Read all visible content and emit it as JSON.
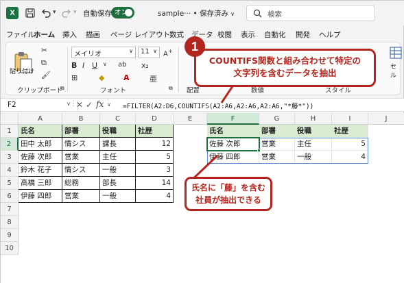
{
  "titlebar": {
    "app_icon": "X",
    "autosave_label": "自動保存",
    "autosave_state": "オン",
    "file_title": "sample··· • 保存済み",
    "search_placeholder": "検索"
  },
  "ribbon_tabs": [
    "ファイル",
    "ホーム",
    "挿入",
    "描画",
    "ページ レイアウト",
    "数式",
    "データ",
    "校閲",
    "表示",
    "自動化",
    "開発",
    "ヘルプ"
  ],
  "ribbon": {
    "paste_label": "貼り付け",
    "clipboard_label": "クリップボード",
    "font_name": "メイリオ",
    "font_size": "11",
    "font_label": "フォント",
    "align_label": "配置",
    "number_label": "数値",
    "style_label": "スタイル",
    "cell_label": "セル"
  },
  "formula_bar": {
    "name_box": "F2",
    "fx": "fx",
    "formula": "=FILTER(A2:D6,COUNTIFS(A2:A6,A2:A6,A2:A6,\"*藤*\"))"
  },
  "columns": [
    "A",
    "B",
    "C",
    "D",
    "E",
    "F",
    "G",
    "H",
    "I",
    "J"
  ],
  "rows": [
    "1",
    "2",
    "3",
    "4",
    "5",
    "6",
    "7",
    "8",
    "9",
    "10"
  ],
  "source_table": {
    "headers": [
      "氏名",
      "部署",
      "役職",
      "社歴"
    ],
    "rows": [
      [
        "田中 太郎",
        "情シス",
        "課長",
        "12"
      ],
      [
        "佐藤 次郎",
        "営業",
        "主任",
        "5"
      ],
      [
        "鈴木 花子",
        "情シス",
        "一般",
        "3"
      ],
      [
        "高橋 三郎",
        "総務",
        "部長",
        "14"
      ],
      [
        "伊藤 四郎",
        "営業",
        "一般",
        "4"
      ]
    ]
  },
  "result_table": {
    "headers": [
      "氏名",
      "部署",
      "役職",
      "社歴"
    ],
    "rows": [
      [
        "佐藤 次郎",
        "営業",
        "主任",
        "5"
      ],
      [
        "伊藤 四郎",
        "営業",
        "一般",
        "4"
      ]
    ]
  },
  "callouts": {
    "badge": "1",
    "callout1_line1": "COUNTIFS関数と組み合わせて特定の",
    "callout1_line2": "文字列を含むデータを抽出",
    "callout2_line1": "氏名に「藤」を含む",
    "callout2_line2": "社員が抽出できる"
  },
  "colors": {
    "excel_green": "#1e6e3f",
    "header_fill": "#d9ecd2",
    "callout_red": "#b3261e"
  }
}
